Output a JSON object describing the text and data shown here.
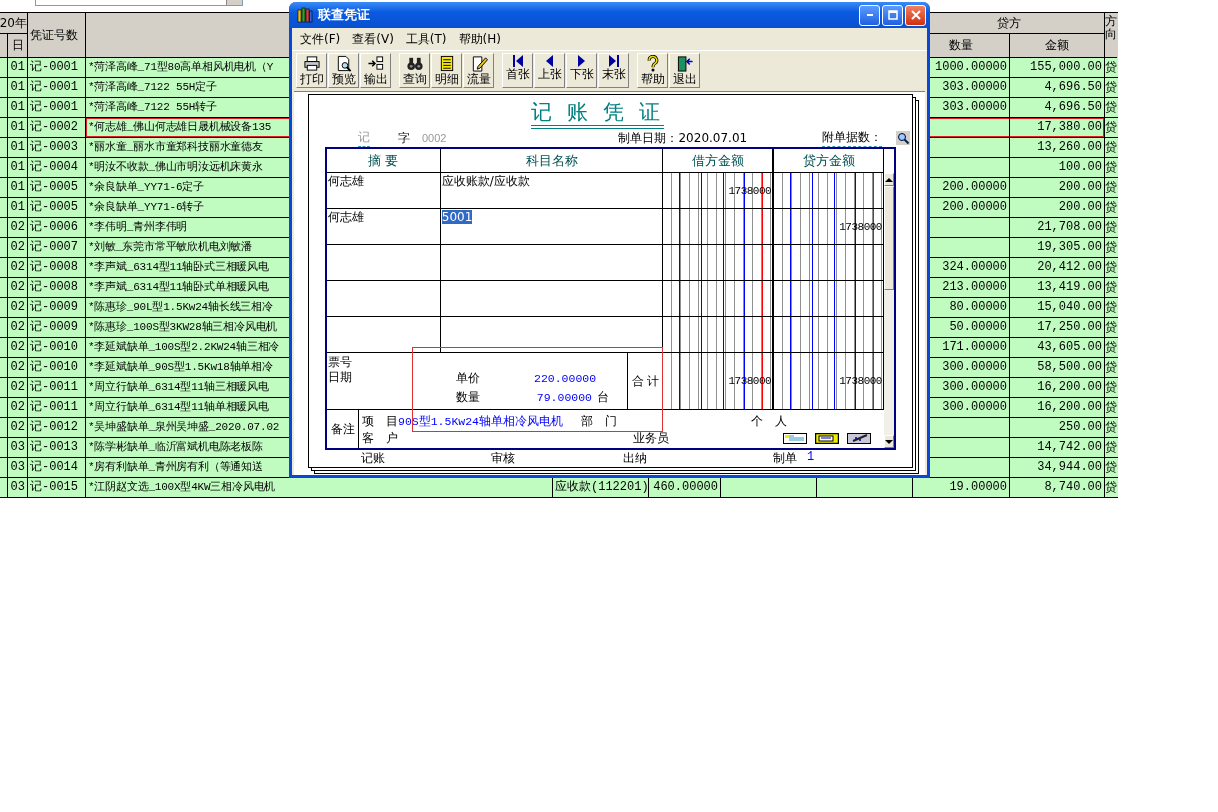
{
  "ledger": {
    "header": {
      "year": "20年",
      "day": "日",
      "voucher_no": "凭证号数",
      "credit": "贷方",
      "credit_qty": "数量",
      "credit_amount": "金额",
      "direction": "方向"
    },
    "rows": [
      {
        "day": "01",
        "voucher_no": "记-0001",
        "summary": "*菏泽高峰_71型80高单相风机电机（Y",
        "qty": "1000.00000",
        "amount": "155,000.00",
        "direction": "贷",
        "selected": false
      },
      {
        "day": "01",
        "voucher_no": "记-0001",
        "summary": "*菏泽高峰_7122 55H定子",
        "qty": "303.00000",
        "amount": "4,696.50",
        "direction": "贷",
        "selected": false
      },
      {
        "day": "01",
        "voucher_no": "记-0001",
        "summary": "*菏泽高峰_7122 55H转子",
        "qty": "303.00000",
        "amount": "4,696.50",
        "direction": "贷",
        "selected": false
      },
      {
        "day": "01",
        "voucher_no": "记-0002",
        "summary": "*何志雄_佛山何志雄日晟机械设备135",
        "amount": "17,380.00",
        "direction": "贷",
        "selected": true
      },
      {
        "day": "01",
        "voucher_no": "记-0003",
        "summary": "*丽水童_丽水市童郑科技丽水童德友",
        "amount": "13,260.00",
        "direction": "贷",
        "selected": false
      },
      {
        "day": "01",
        "voucher_no": "记-0004",
        "summary": "*明汝不收款_佛山市明汝远机床黄永",
        "amount": "100.00",
        "direction": "贷",
        "selected": false
      },
      {
        "day": "01",
        "voucher_no": "记-0005",
        "summary": "*余良缺单_YY71-6定子",
        "qty": "200.00000",
        "amount": "200.00",
        "direction": "贷",
        "selected": false
      },
      {
        "day": "01",
        "voucher_no": "记-0005",
        "summary": "*余良缺单_YY71-6转子",
        "qty": "200.00000",
        "amount": "200.00",
        "direction": "贷",
        "selected": false
      },
      {
        "day": "02",
        "voucher_no": "记-0006",
        "summary": "*李伟明_青州李伟明",
        "amount": "21,708.00",
        "direction": "贷",
        "selected": false
      },
      {
        "day": "02",
        "voucher_no": "记-0007",
        "summary": "*刘敏_东莞市常平敏欣机电刘敏潘",
        "amount": "19,305.00",
        "direction": "贷",
        "selected": false
      },
      {
        "day": "02",
        "voucher_no": "记-0008",
        "summary": "*李声斌_6314型11轴卧式三相暖风电",
        "qty": "324.00000",
        "amount": "20,412.00",
        "direction": "贷",
        "selected": false
      },
      {
        "day": "02",
        "voucher_no": "记-0008",
        "summary": "*李声斌_6314型11轴卧式单相暖风电",
        "qty": "213.00000",
        "amount": "13,419.00",
        "direction": "贷",
        "selected": false
      },
      {
        "day": "02",
        "voucher_no": "记-0009",
        "summary": "*陈惠珍_90L型1.5Kw24轴长线三相冷",
        "qty": "80.00000",
        "amount": "15,040.00",
        "direction": "贷",
        "selected": false
      },
      {
        "day": "02",
        "voucher_no": "记-0009",
        "summary": "*陈惠珍_100S型3KW28轴三相冷风电机",
        "qty": "50.00000",
        "amount": "17,250.00",
        "direction": "贷",
        "selected": false
      },
      {
        "day": "02",
        "voucher_no": "记-0010",
        "summary": "*李延斌缺单_100S型2.2KW24轴三相冷",
        "qty": "171.00000",
        "amount": "43,605.00",
        "direction": "贷",
        "selected": false
      },
      {
        "day": "02",
        "voucher_no": "记-0010",
        "summary": "*李延斌缺单_90S型1.5Kw18轴单相冷",
        "qty": "300.00000",
        "amount": "58,500.00",
        "direction": "贷",
        "selected": false
      },
      {
        "day": "02",
        "voucher_no": "记-0011",
        "summary": "*周立行缺单_6314型11轴三相暖风电",
        "qty": "300.00000",
        "amount": "16,200.00",
        "direction": "贷",
        "selected": false
      },
      {
        "day": "02",
        "voucher_no": "记-0011",
        "summary": "*周立行缺单_6314型11轴单相暖风电",
        "qty": "300.00000",
        "amount": "16,200.00",
        "direction": "贷",
        "selected": false
      },
      {
        "day": "02",
        "voucher_no": "记-0012",
        "summary": "*吴坤盛缺单_泉州吴坤盛_2020.07.02",
        "amount": "250.00",
        "direction": "贷",
        "selected": false
      },
      {
        "day": "03",
        "voucher_no": "记-0013",
        "summary": "*陈学彬缺单_临沂富斌机电陈老板陈",
        "amount": "14,742.00",
        "direction": "贷",
        "selected": false
      },
      {
        "day": "03",
        "voucher_no": "记-0014",
        "summary": "*房有利缺单_青州房有利（等通知送",
        "amount": "34,944.00",
        "direction": "贷",
        "selected": false
      },
      {
        "day": "03",
        "voucher_no": "记-0015",
        "summary": "*江阴赵文选_100X型4KW三相冷风电机",
        "column_5": "应收款(112201)",
        "column_6": "460.00000",
        "qty": "19.00000",
        "amount": "8,740.00",
        "direction": "贷",
        "selected": false
      }
    ]
  },
  "dialog": {
    "title": "联查凭证",
    "menu": [
      "文件(F)",
      "查看(V)",
      "工具(T)",
      "帮助(H)"
    ],
    "toolbar": [
      [
        {
          "label": "打印",
          "kind": "print"
        },
        {
          "label": "预览",
          "kind": "preview"
        },
        {
          "label": "输出",
          "kind": "export"
        }
      ],
      [
        {
          "label": "查询",
          "kind": "find"
        },
        {
          "label": "明细",
          "kind": "detail"
        },
        {
          "label": "流量",
          "kind": "flow"
        }
      ],
      [
        {
          "label": "首张",
          "kind": "first"
        },
        {
          "label": "上张",
          "kind": "prev"
        },
        {
          "label": "下张",
          "kind": "next"
        },
        {
          "label": "末张",
          "kind": "last"
        }
      ],
      [
        {
          "label": "帮助",
          "kind": "help"
        },
        {
          "label": "退出",
          "kind": "exit"
        }
      ]
    ],
    "voucher": {
      "title": "记 账 凭 证",
      "type": "记",
      "type_suffix": "字",
      "number": "0002",
      "date": "制单日期：2020.07.01",
      "attachments_label": "附单据数：",
      "columns": [
        "摘 要",
        "科目名称",
        "借方金额",
        "贷方金额"
      ],
      "entries": [
        {
          "summary": "何志雄",
          "account": "应收账款/应收款",
          "debit": "1738000",
          "editing": false
        },
        {
          "summary": "何志雄",
          "account": "5001",
          "credit": "1738000",
          "editing": true
        }
      ],
      "ticket_label": "票号",
      "ticket_date_label": "日期",
      "unit_price_label": "单价",
      "unit_price": "220.00000",
      "quantity_label": "数量",
      "quantity": "79.00000",
      "unit": "台",
      "total_label": "合 计",
      "total_debit": "1738000",
      "total_credit": "1738000",
      "remarks_label": "备注",
      "project_label": "项　目",
      "project": "90S型1.5Kw24轴单相冷风电机",
      "department_label": "部　门",
      "person_label": "个　人",
      "customer_label": "客　户",
      "salesperson_label": "业务员",
      "signatures": [
        {
          "label": "记账"
        },
        {
          "label": "审核"
        },
        {
          "label": "出纳"
        },
        {
          "label": "制单",
          "value": "1"
        }
      ]
    }
  }
}
